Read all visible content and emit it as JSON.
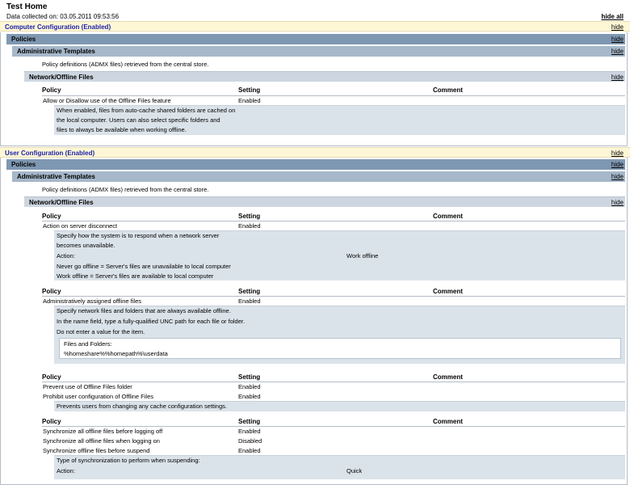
{
  "title": "Test Home",
  "collected": "Data collected on: 03.05.2011 09:53:56",
  "hide_all": "hide all",
  "hide": "hide",
  "colors": {
    "config_band": "#fef7d6",
    "config_text": "#1d22a8",
    "policies_band": "#7f98b2",
    "admin_band": "#a6b8ca",
    "net_band": "#cdd6e0",
    "explain_bg": "#dbe3ea"
  },
  "computer": {
    "label": "Computer Configuration (Enabled)",
    "policies": "Policies",
    "admin": "Administrative Templates",
    "admin_desc": "Policy definitions (ADMX files) retrieved from the central store.",
    "net": "Network/Offline Files",
    "headers": {
      "policy": "Policy",
      "setting": "Setting",
      "comment": "Comment"
    },
    "row1": {
      "policy": "Allow or Disallow use of the Offline Files feature",
      "setting": "Enabled"
    },
    "explain1": [
      "When enabled, files from auto-cache shared folders are cached on",
      "the local computer. Users can also select specific folders and",
      "files to always be available when working offline."
    ]
  },
  "user": {
    "label": "User Configuration (Enabled)",
    "policies": "Policies",
    "admin": "Administrative Templates",
    "admin_desc": "Policy definitions (ADMX files) retrieved from the central store.",
    "net": "Network/Offline Files",
    "headers": {
      "policy": "Policy",
      "setting": "Setting",
      "comment": "Comment"
    },
    "g1": {
      "row": {
        "policy": "Action on server disconnect",
        "setting": "Enabled"
      },
      "explain": [
        "Specify how the system is to respond when a network server",
        "becomes unavailable.",
        "Action:",
        "Never go offline = Server's files are unavailable to local computer",
        "Work offline = Server's files are available to local computer"
      ],
      "action_value": "Work offline"
    },
    "g2": {
      "row": {
        "policy": "Administratively assigned offline files",
        "setting": "Enabled"
      },
      "explain": [
        "Specify network files and folders that are always available offline.",
        "In the name field, type a fully-qualified UNC path for each file or folder.",
        "Do not enter a value for the item."
      ],
      "box_label": "Files and Folders:",
      "box_value": "%homeshare%%homepath%\\userdata"
    },
    "g3": {
      "row1": {
        "policy": "Prevent use of Offline Files folder",
        "setting": "Enabled"
      },
      "row2": {
        "policy": "Prohibit user configuration of Offline Files",
        "setting": "Enabled"
      },
      "explain": "Prevents users from changing any cache configuration settings."
    },
    "g4": {
      "row1": {
        "policy": "Synchronize all offline files before logging off",
        "setting": "Enabled"
      },
      "row2": {
        "policy": "Synchronize all offline files when logging on",
        "setting": "Disabled"
      },
      "row3": {
        "policy": "Synchronize offline files before suspend",
        "setting": "Enabled"
      },
      "explain": "Type of synchronization to perform when suspending:",
      "action_label": "Action:",
      "action_value": "Quick"
    }
  }
}
